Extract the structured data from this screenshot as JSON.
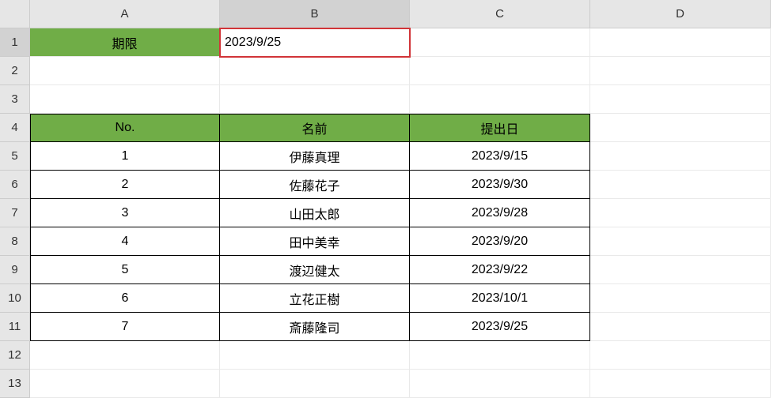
{
  "columns": [
    "A",
    "B",
    "C",
    "D"
  ],
  "row_count": 13,
  "active_cell": {
    "row": 1,
    "col": "B"
  },
  "cells": {
    "A1": {
      "value": "期限",
      "align": "center",
      "fill": "green"
    },
    "B1": {
      "value": "2023/9/25",
      "align": "left"
    },
    "A4": {
      "value": "No.",
      "align": "center",
      "fill": "green",
      "table": true,
      "top": true,
      "left": true
    },
    "B4": {
      "value": "名前",
      "align": "center",
      "fill": "green",
      "table": true,
      "top": true
    },
    "C4": {
      "value": "提出日",
      "align": "center",
      "fill": "green",
      "table": true,
      "top": true
    },
    "A5": {
      "value": "1",
      "align": "center",
      "table": true,
      "left": true
    },
    "B5": {
      "value": "伊藤真理",
      "align": "center",
      "table": true
    },
    "C5": {
      "value": "2023/9/15",
      "align": "center",
      "table": true
    },
    "A6": {
      "value": "2",
      "align": "center",
      "table": true,
      "left": true
    },
    "B6": {
      "value": "佐藤花子",
      "align": "center",
      "table": true
    },
    "C6": {
      "value": "2023/9/30",
      "align": "center",
      "table": true
    },
    "A7": {
      "value": "3",
      "align": "center",
      "table": true,
      "left": true
    },
    "B7": {
      "value": "山田太郎",
      "align": "center",
      "table": true
    },
    "C7": {
      "value": "2023/9/28",
      "align": "center",
      "table": true
    },
    "A8": {
      "value": "4",
      "align": "center",
      "table": true,
      "left": true
    },
    "B8": {
      "value": "田中美幸",
      "align": "center",
      "table": true
    },
    "C8": {
      "value": "2023/9/20",
      "align": "center",
      "table": true
    },
    "A9": {
      "value": "5",
      "align": "center",
      "table": true,
      "left": true
    },
    "B9": {
      "value": "渡辺健太",
      "align": "center",
      "table": true
    },
    "C9": {
      "value": "2023/9/22",
      "align": "center",
      "table": true
    },
    "A10": {
      "value": "6",
      "align": "center",
      "table": true,
      "left": true
    },
    "B10": {
      "value": "立花正樹",
      "align": "center",
      "table": true
    },
    "C10": {
      "value": "2023/10/1",
      "align": "center",
      "table": true
    },
    "A11": {
      "value": "7",
      "align": "center",
      "table": true,
      "left": true
    },
    "B11": {
      "value": "斎藤隆司",
      "align": "center",
      "table": true
    },
    "C11": {
      "value": "2023/9/25",
      "align": "center",
      "table": true
    }
  }
}
